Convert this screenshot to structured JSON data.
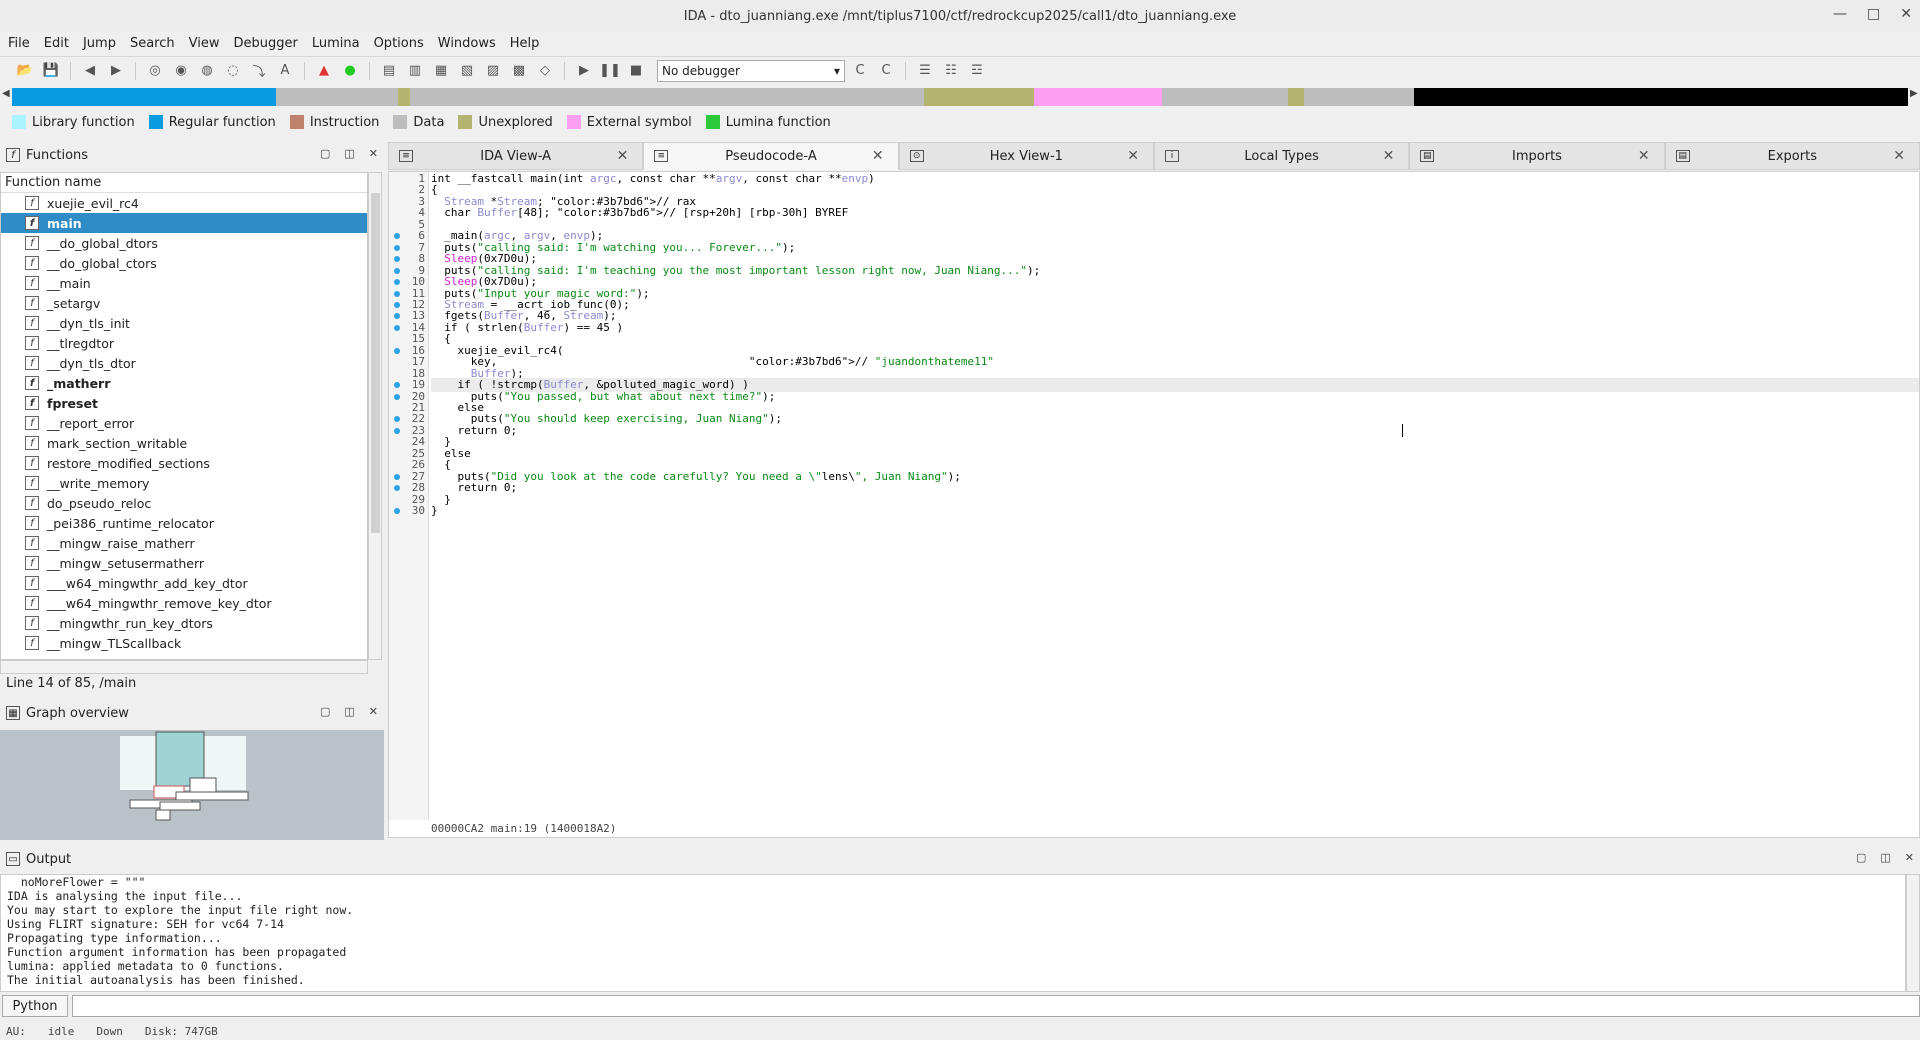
{
  "window": {
    "title": "IDA - dto_juanniang.exe /mnt/tiplus7100/ctf/redrockcup2025/call1/dto_juanniang.exe",
    "controls": [
      "—",
      "□",
      "✕"
    ]
  },
  "menu": [
    "File",
    "Edit",
    "Jump",
    "Search",
    "View",
    "Debugger",
    "Lumina",
    "Options",
    "Windows",
    "Help"
  ],
  "toolbar": {
    "debugger_value": "No debugger"
  },
  "legend": [
    {
      "label": "Library function",
      "color": "#aaf3ff"
    },
    {
      "label": "Regular function",
      "color": "#0b9be2"
    },
    {
      "label": "Instruction",
      "color": "#bf826a"
    },
    {
      "label": "Data",
      "color": "#bdbdbd"
    },
    {
      "label": "Unexplored",
      "color": "#b3b46f"
    },
    {
      "label": "External symbol",
      "color": "#ff9ff4"
    },
    {
      "label": "Lumina function",
      "color": "#2ec93a"
    }
  ],
  "functions_panel": {
    "title": "Functions",
    "column_header": "Function name",
    "items": [
      "xuejie_evil_rc4",
      "main",
      "__do_global_dtors",
      "__do_global_ctors",
      "__main",
      "_setargv",
      "__dyn_tls_init",
      "__tlregdtor",
      "__dyn_tls_dtor",
      "_matherr",
      "fpreset",
      "__report_error",
      "mark_section_writable",
      "restore_modified_sections",
      "__write_memory",
      "do_pseudo_reloc",
      "_pei386_runtime_relocator",
      "__mingw_raise_matherr",
      "__mingw_setusermatherr",
      "___w64_mingwthr_add_key_dtor",
      "___w64_mingwthr_remove_key_dtor",
      "__mingwthr_run_key_dtors",
      "__mingw_TLScallback"
    ],
    "selected": "main",
    "status": "Line 14 of 85, /main"
  },
  "graph_panel": {
    "title": "Graph overview"
  },
  "tabs": [
    {
      "label": "IDA View-A",
      "icon": "text-view-icon"
    },
    {
      "label": "Pseudocode-A",
      "icon": "pseudocode-icon"
    },
    {
      "label": "Hex View-1",
      "icon": "hex-icon"
    },
    {
      "label": "Local Types",
      "icon": "info-icon"
    },
    {
      "label": "Imports",
      "icon": "imports-icon"
    },
    {
      "label": "Exports",
      "icon": "exports-icon"
    }
  ],
  "active_tab": "Pseudocode-A",
  "code": {
    "lines": [
      {
        "n": "1",
        "dot": false,
        "text": "int __fastcall main(int argc, const char **argv, const char **envp)"
      },
      {
        "n": "2",
        "dot": false,
        "text": "{"
      },
      {
        "n": "3",
        "dot": false,
        "text": "  Stream *Stream; // rax"
      },
      {
        "n": "4",
        "dot": false,
        "text": "  char Buffer[48]; // [rsp+20h] [rbp-30h] BYREF"
      },
      {
        "n": "5",
        "dot": false,
        "text": ""
      },
      {
        "n": "6",
        "dot": true,
        "text": "  _main(argc, argv, envp);"
      },
      {
        "n": "7",
        "dot": true,
        "text": "  puts(\"calling said: I'm watching you... Forever...\");"
      },
      {
        "n": "8",
        "dot": true,
        "text": "  Sleep(0x7D0u);"
      },
      {
        "n": "9",
        "dot": true,
        "text": "  puts(\"calling said: I'm teaching you the most important lesson right now, Juan Niang...\");"
      },
      {
        "n": "10",
        "dot": true,
        "text": "  Sleep(0x7D0u);"
      },
      {
        "n": "11",
        "dot": true,
        "text": "  puts(\"Input your magic word:\");"
      },
      {
        "n": "12",
        "dot": true,
        "text": "  Stream = __acrt_iob_func(0);"
      },
      {
        "n": "13",
        "dot": true,
        "text": "  fgets(Buffer, 46, Stream);"
      },
      {
        "n": "14",
        "dot": true,
        "text": "  if ( strlen(Buffer) == 45 )"
      },
      {
        "n": "15",
        "dot": false,
        "text": "  {"
      },
      {
        "n": "16",
        "dot": true,
        "text": "    xuejie_evil_rc4("
      },
      {
        "n": "17",
        "dot": false,
        "text": "      key,                                      // \"juandonthateme11\""
      },
      {
        "n": "18",
        "dot": false,
        "text": "      Buffer);"
      },
      {
        "n": "19",
        "dot": true,
        "text": "    if ( !strcmp(Buffer, &polluted_magic_word) )"
      },
      {
        "n": "20",
        "dot": true,
        "text": "      puts(\"You passed, but what about next time?\");"
      },
      {
        "n": "21",
        "dot": false,
        "text": "    else"
      },
      {
        "n": "22",
        "dot": true,
        "text": "      puts(\"You should keep exercising, Juan Niang\");"
      },
      {
        "n": "23",
        "dot": true,
        "text": "    return 0;"
      },
      {
        "n": "24",
        "dot": false,
        "text": "  }"
      },
      {
        "n": "25",
        "dot": false,
        "text": "  else"
      },
      {
        "n": "26",
        "dot": false,
        "text": "  {"
      },
      {
        "n": "27",
        "dot": true,
        "text": "    puts(\"Did you look at the code carefully? You need a \\\"lens\\\", Juan Niang\");"
      },
      {
        "n": "28",
        "dot": true,
        "text": "    return 0;"
      },
      {
        "n": "29",
        "dot": false,
        "text": "  }"
      },
      {
        "n": "30",
        "dot": true,
        "text": "}"
      }
    ],
    "highlighted_line": "19",
    "status": "00000CA2 main:19 (1400018A2)"
  },
  "output": {
    "title": "Output",
    "lines": [
      "  noMoreFlower = \"\"\"",
      "IDA is analysing the input file...",
      "You may start to explore the input file right now.",
      "Using FLIRT signature: SEH for vc64 7-14",
      "Propagating type information...",
      "Function argument information has been propagated",
      "lumina: applied metadata to 0 functions.",
      "The initial autoanalysis has been finished."
    ],
    "python_label": "Python"
  },
  "statusbar": {
    "au": "AU:",
    "state": "idle",
    "direction": "Down",
    "disk": "Disk: 747GB"
  }
}
